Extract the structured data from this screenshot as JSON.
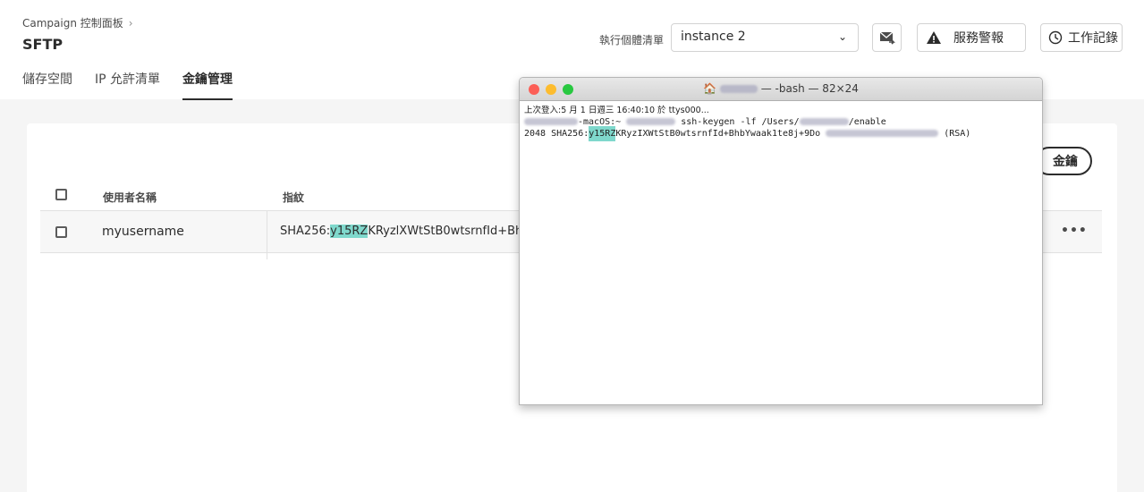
{
  "header": {
    "breadcrumb": "Campaign 控制面板",
    "title": "SFTP",
    "tabs": [
      {
        "label": "儲存空間"
      },
      {
        "label": "IP 允許清單"
      },
      {
        "label": "金鑰管理",
        "active": true
      }
    ],
    "instance_label": "執行個體清單",
    "instance_value": "instance 2",
    "alerts_label": "服務警報",
    "log_label": "工作記錄"
  },
  "card": {
    "add_button_label": "金鑰",
    "columns": {
      "username": "使用者名稱",
      "fingerprint": "指紋"
    },
    "rows": [
      {
        "username": "myusername",
        "fp_prefix": "SHA256:",
        "fp_highlight": "y15RZ",
        "fp_rest": "KRyzlXWtStB0wtsrnfId+BhbYwaak",
        "more": "•••"
      }
    ]
  },
  "terminal": {
    "title_suffix": "— -bash — 82×24",
    "login_line": "上次登入:5 月 1 日週三 16:40:10 於 ttys000...",
    "cmd_mid": "-macOS:~",
    "cmd_text": "ssh-keygen -lf /Users/",
    "cmd_end": "/enable",
    "out_prefix": "2048 SHA256:",
    "out_highlight": "y15RZ",
    "out_rest": "KRyzIXWtStB0wtsrnfId+BhbYwaak1te8j+9Do",
    "out_end": "(RSA)"
  },
  "colors": {
    "highlight": "#7fd8cc",
    "background": "#f5f5f5"
  }
}
